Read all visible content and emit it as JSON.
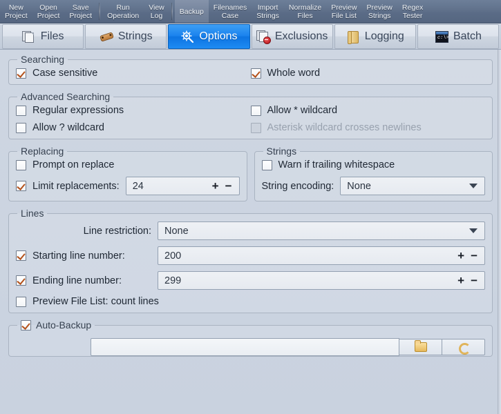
{
  "ribbon": {
    "items": [
      {
        "label": "New\nProject",
        "name": "new-project",
        "hover": false,
        "sep_after": false
      },
      {
        "label": "Open\nProject",
        "name": "open-project",
        "hover": false,
        "sep_after": false
      },
      {
        "label": "Save\nProject",
        "name": "save-project",
        "hover": false,
        "sep_after": true
      },
      {
        "label": "Run\nOperation",
        "name": "run-operation",
        "hover": false,
        "sep_after": false
      },
      {
        "label": "View\nLog",
        "name": "view-log",
        "hover": false,
        "sep_after": true
      },
      {
        "label": "Backup",
        "name": "backup",
        "hover": true,
        "sep_after": false
      },
      {
        "label": "Filenames\nCase",
        "name": "filenames-case",
        "hover": false,
        "sep_after": false
      },
      {
        "label": "Import\nStrings",
        "name": "import-strings",
        "hover": false,
        "sep_after": false
      },
      {
        "label": "Normalize\nFiles",
        "name": "normalize-files",
        "hover": false,
        "sep_after": false
      },
      {
        "label": "Preview\nFile List",
        "name": "preview-file-list",
        "hover": false,
        "sep_after": false
      },
      {
        "label": "Preview\nStrings",
        "name": "preview-strings",
        "hover": false,
        "sep_after": false
      },
      {
        "label": "Regex\nTester",
        "name": "regex-tester",
        "hover": false,
        "sep_after": false
      }
    ]
  },
  "tabs": [
    {
      "label": "Files",
      "icon": "files-icon",
      "active": false
    },
    {
      "label": "Strings",
      "icon": "strings-pen-icon",
      "active": false
    },
    {
      "label": "Options",
      "icon": "options-gear-icon",
      "active": true
    },
    {
      "label": "Exclusions",
      "icon": "exclusions-icon",
      "active": false
    },
    {
      "label": "Logging",
      "icon": "logging-scroll-icon",
      "active": false
    },
    {
      "label": "Batch",
      "icon": "batch-console-icon",
      "active": false
    }
  ],
  "groups": {
    "searching": {
      "legend": "Searching",
      "case_sensitive": {
        "label": "Case sensitive",
        "checked": true,
        "disabled": false
      },
      "whole_word": {
        "label": "Whole word",
        "checked": true,
        "disabled": false
      }
    },
    "advanced_searching": {
      "legend": "Advanced Searching",
      "regular_expressions": {
        "label": "Regular expressions",
        "checked": false,
        "disabled": false
      },
      "allow_star_wildcard": {
        "label": "Allow * wildcard",
        "checked": false,
        "disabled": false
      },
      "allow_question_wildcard": {
        "label": "Allow ? wildcard",
        "checked": false,
        "disabled": false
      },
      "asterisk_crosses_newlines": {
        "label": "Asterisk wildcard crosses newlines",
        "checked": false,
        "disabled": true
      }
    },
    "replacing": {
      "legend": "Replacing",
      "prompt_on_replace": {
        "label": "Prompt on replace",
        "checked": false,
        "disabled": false
      },
      "limit_replacements": {
        "label": "Limit replacements:",
        "checked": true,
        "disabled": false
      },
      "limit_value": "24",
      "spin_plus": "+",
      "spin_minus": "−"
    },
    "strings": {
      "legend": "Strings",
      "warn_trailing_whitespace": {
        "label": "Warn if trailing whitespace",
        "checked": false,
        "disabled": false
      },
      "string_encoding_label": "String encoding:",
      "string_encoding_value": "None"
    },
    "lines": {
      "legend": "Lines",
      "line_restriction_label": "Line restriction:",
      "line_restriction_value": "None",
      "starting_line": {
        "label": "Starting line number:",
        "checked": true,
        "value": "200"
      },
      "ending_line": {
        "label": "Ending line number:",
        "checked": true,
        "value": "299"
      },
      "preview_count_lines": {
        "label": "Preview File List: count lines",
        "checked": false,
        "disabled": false
      },
      "spin_plus": "+",
      "spin_minus": "−"
    },
    "auto_backup": {
      "legend": "Auto-Backup",
      "checked": true,
      "path_value": "",
      "browse_icon": "folder-icon",
      "refresh_icon": "refresh-icon"
    }
  },
  "colors": {
    "accent_tab_active": "#0d74e2",
    "checkmark": "#b4521c",
    "ribbon_bg": "#62738d",
    "page_bg": "#ced6e2"
  }
}
